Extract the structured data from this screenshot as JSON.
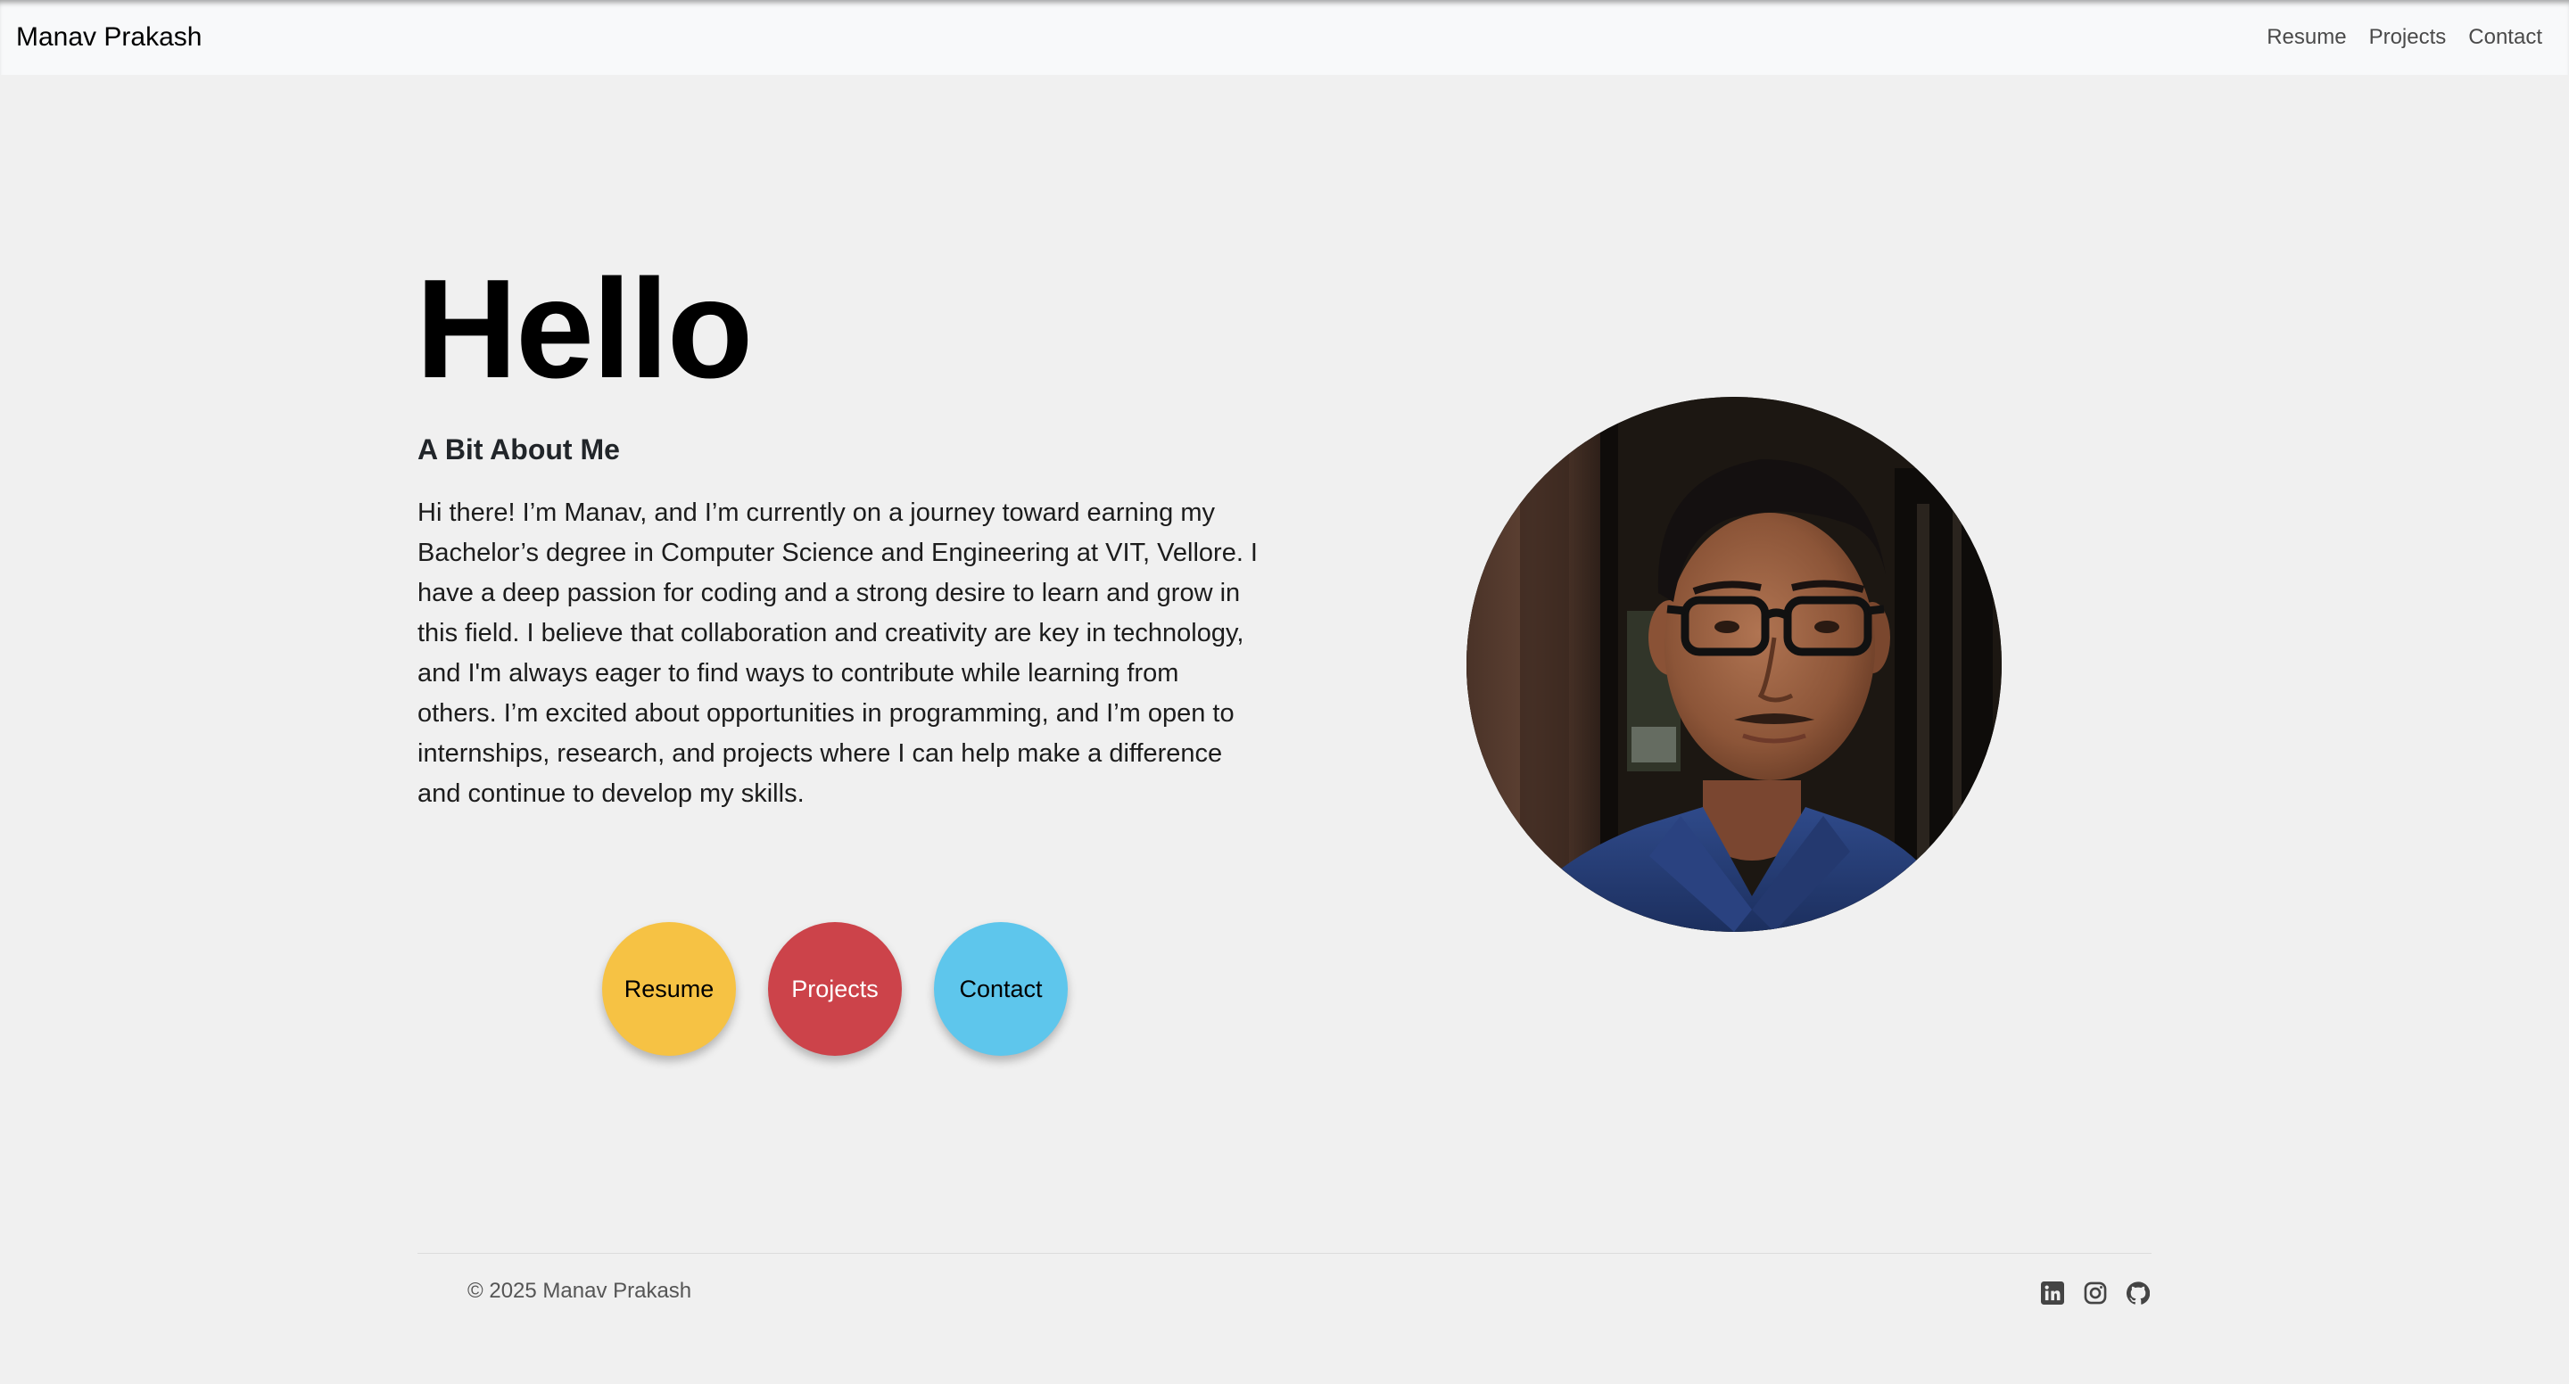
{
  "navbar": {
    "brand": "Manav Prakash",
    "links": [
      "Resume",
      "Projects",
      "Contact"
    ]
  },
  "hero": {
    "title": "Hello",
    "about_heading": "A Bit About Me",
    "about_text": "Hi there! I’m Manav, and I’m currently on a journey toward earning my Bachelor’s degree in Computer Science and Engineering at VIT, Vellore. I have a deep passion for coding and a strong desire to learn and grow in this field. I believe that collaboration and creativity are key in technology, and I'm always eager to find ways to contribute while learning from others. I’m excited about opportunities in programming, and I’m open to internships, research, and projects where I can help make a difference and continue to develop my skills."
  },
  "buttons": [
    {
      "label": "Resume",
      "color": "#f6c244"
    },
    {
      "label": "Projects",
      "color": "#cc434a"
    },
    {
      "label": "Contact",
      "color": "#5ec6ec"
    }
  ],
  "footer": {
    "copyright": "© 2025 Manav Prakash",
    "social_icons": [
      "linkedin-icon",
      "instagram-icon",
      "github-icon"
    ]
  },
  "colors": {
    "background": "#f0f0f0",
    "navbar_bg": "#f8f9fa"
  }
}
